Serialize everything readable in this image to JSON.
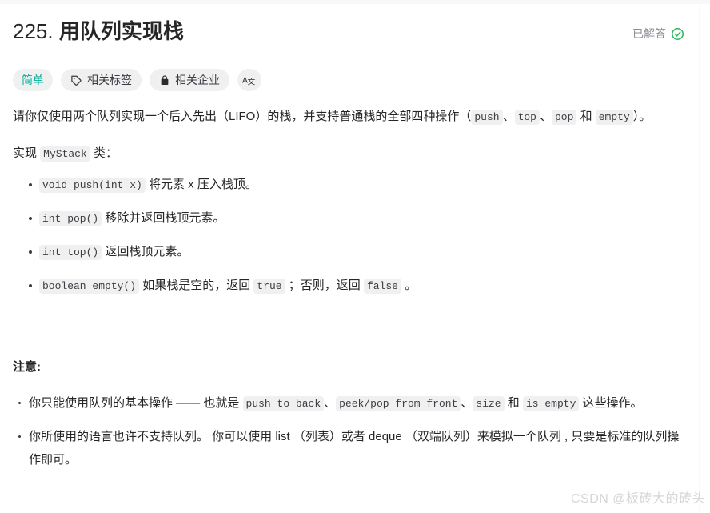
{
  "header": {
    "title_number": "225.",
    "title_name": "用队列实现栈",
    "solved_label": "已解答",
    "solved_icon": "check-circle-icon",
    "solved_color": "#2db55d"
  },
  "pills": [
    {
      "label": "简单",
      "icon": null,
      "kind": "difficulty",
      "color": "#00af9b"
    },
    {
      "label": "相关标签",
      "icon": "tag-icon",
      "kind": "action"
    },
    {
      "label": "相关企业",
      "icon": "lock-icon",
      "kind": "action"
    },
    {
      "label": "",
      "icon": "translate-icon",
      "kind": "icon-only"
    }
  ],
  "content": {
    "intro": {
      "p1_a": "请你仅使用两个队列实现一个后入先出（LIFO）的栈，并支持普通栈的全部四种操作（",
      "code_push": "push",
      "sep1": "、",
      "code_top": "top",
      "sep2": "、",
      "code_pop": "pop",
      "p1_b": " 和 ",
      "code_empty": "empty",
      "p1_c": "）。",
      "p2_a": "实现 ",
      "code_mystack": "MyStack",
      "p2_b": " 类："
    },
    "methods": [
      {
        "code": "void push(int x)",
        "text": "将元素 x 压入栈顶。"
      },
      {
        "code": "int pop()",
        "text": "移除并返回栈顶元素。"
      },
      {
        "code": "int top()",
        "text": "返回栈顶元素。"
      }
    ],
    "method_empty": {
      "code": "boolean empty()",
      "text_a": "如果栈是空的，返回 ",
      "code_true": "true",
      "text_b": " ；否则，返回 ",
      "code_false": "false",
      "text_c": " 。"
    },
    "notice_title": "注意:",
    "note1": {
      "a": "你只能使用队列的基本操作 —— 也就是 ",
      "code1": "push to back",
      "s1": "、",
      "code2": "peek/pop from front",
      "s2": "、",
      "code3": "size",
      "s3": " 和 ",
      "code4": "is empty",
      "b": " 这些操作。"
    },
    "note2": "你所使用的语言也许不支持队列。 你可以使用 list （列表）或者 deque （双端队列）来模拟一个队列 , 只要是标准的队列操作即可。"
  },
  "watermark": "CSDN @板砖大的砖头"
}
